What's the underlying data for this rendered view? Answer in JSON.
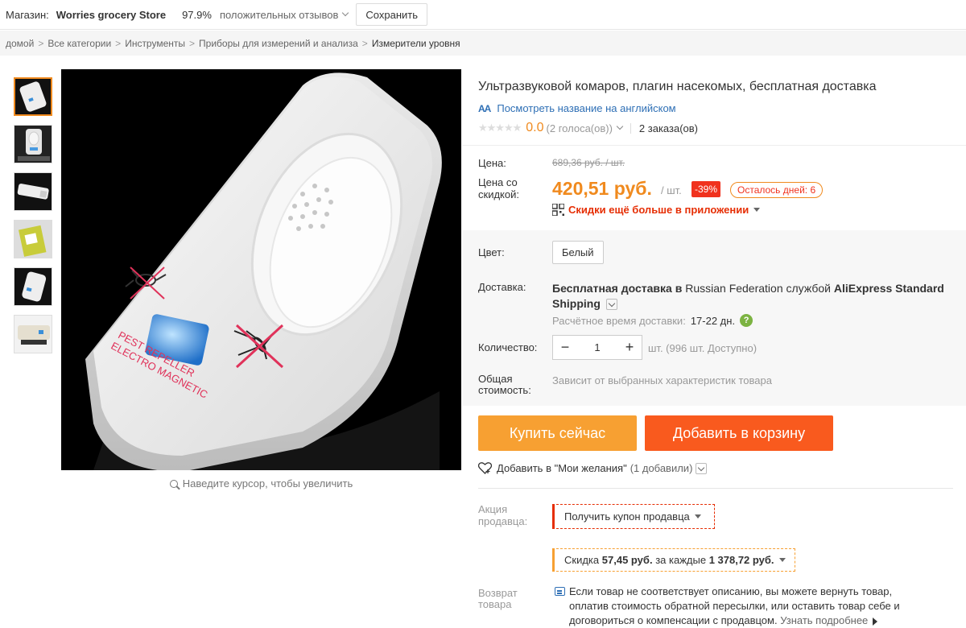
{
  "store": {
    "label": "Магазин:",
    "name": "Worries grocery Store",
    "rating": "97.9%",
    "feedback": "положительных отзывов",
    "save": "Сохранить"
  },
  "breadcrumb": [
    "домой",
    "Все категории",
    "Инструменты",
    "Приборы для измерений и анализа",
    "Измерители уровня"
  ],
  "gallery": {
    "zoom_hint": "Наведите курсор, чтобы увеличить",
    "image_text_1": "PEST REPELLER",
    "image_text_2": "ELECTRO MAGNETIC",
    "thumbnail_count": 6
  },
  "product": {
    "title": "Ультразвуковой комаров, плагин насекомых, бесплатная доставка",
    "translate_icon": "AА",
    "translate": "Посмотреть название на английском",
    "stars": "★★★★★",
    "rating": "0.0",
    "votes": "(2 голоса(ов))",
    "orders": "2 заказа(ов)"
  },
  "price": {
    "label": "Цена:",
    "old": "689,36 руб. / шт.",
    "discount_label_1": "Цена со",
    "discount_label_2": "скидкой:",
    "new": "420,51 руб.",
    "per_unit": "/ шт.",
    "discount": "-39%",
    "days_left": "Осталось дней: 6",
    "app_promo": "Скидки ещё больше в приложении"
  },
  "options": {
    "color_label": "Цвет:",
    "color_value": "Белый",
    "shipping_label": "Доставка:",
    "shipping_bold_1": "Бесплатная доставка в",
    "shipping_country": "Russian Federation",
    "shipping_by": "службой",
    "shipping_service": "AliExpress Standard Shipping",
    "delivery_time_label": "Расчётное время доставки:",
    "delivery_days": "17-22 дн.",
    "qty_label": "Количество:",
    "qty_minus": "−",
    "qty_value": "1",
    "qty_plus": "+",
    "qty_avail": "шт. (996 шт. Доступно)",
    "total_label_1": "Общая",
    "total_label_2": "стоимость:",
    "total_note": "Зависит от выбранных характеристик товара"
  },
  "actions": {
    "buy_now": "Купить сейчас",
    "add_to_cart": "Добавить в корзину",
    "wishlist": "Добавить в \"Мои желания\"",
    "wishlist_count": "(1 добавили)"
  },
  "promo": {
    "label_1": "Акция",
    "label_2": "продавца:",
    "coupon": "Получить купон продавца",
    "saving_prefix": "Скидка",
    "saving_amount": "57,45 руб.",
    "saving_mid": "за каждые",
    "saving_threshold": "1 378,72 руб."
  },
  "returns": {
    "label_1": "Возврат",
    "label_2": "товара",
    "text": "Если товар не соответствует описанию, вы можете вернуть товар, оплатив стоимость обратной пересылки, или оставить товар себе и договориться о компенсации с продавцом.",
    "more": "Узнать подробнее"
  },
  "colors": {
    "accent_orange": "#f08a1e",
    "buy_now": "#f7a032",
    "add_cart": "#f95a1e",
    "link_blue": "#2e6fb5",
    "promo_red": "#e62e04"
  }
}
